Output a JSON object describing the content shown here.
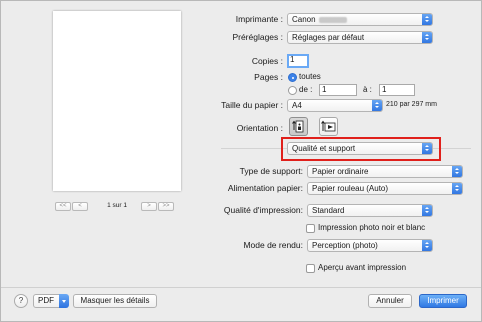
{
  "preview": {
    "pager": [
      "<<",
      "<",
      ">",
      ">>"
    ],
    "label": "1 sur 1"
  },
  "printer": {
    "label": "Imprimante :",
    "value": "Canon"
  },
  "presets": {
    "label": "Préréglages :",
    "value": "Réglages par défaut"
  },
  "copies": {
    "label": "Copies :",
    "value": "1"
  },
  "pages": {
    "label": "Pages :",
    "all_label": "toutes",
    "from_label": "de :",
    "from_value": "1",
    "to_label": "à :",
    "to_value": "1"
  },
  "paper_size": {
    "label": "Taille du papier :",
    "value": "A4",
    "dimensions": "210 par 297 mm"
  },
  "orientation": {
    "label": "Orientation :"
  },
  "panel": {
    "value": "Qualité et support"
  },
  "media_type": {
    "label": "Type de support:",
    "value": "Papier ordinaire"
  },
  "paper_source": {
    "label": "Alimentation papier:",
    "value": "Papier rouleau (Auto)"
  },
  "print_quality": {
    "label": "Qualité d'impression:",
    "value": "Standard"
  },
  "grayscale": {
    "label": "Impression photo noir et blanc"
  },
  "rendering": {
    "label": "Mode de rendu:",
    "value": "Perception (photo)"
  },
  "preview_before": {
    "label": "Aperçu avant impression"
  },
  "footer": {
    "help": "?",
    "pdf": "PDF",
    "hide_details": "Masquer les détails",
    "cancel": "Annuler",
    "print": "Imprimer"
  }
}
